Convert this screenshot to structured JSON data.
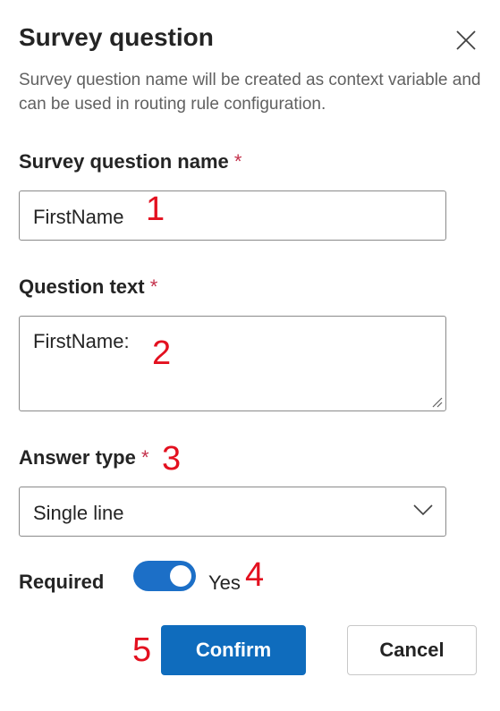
{
  "dialog": {
    "title": "Survey question",
    "description": "Survey question name will be created as context variable and can be used in routing rule configuration."
  },
  "fields": {
    "name": {
      "label": "Survey question name",
      "required_mark": "*",
      "value": "FirstName"
    },
    "question_text": {
      "label": "Question text",
      "required_mark": "*",
      "value": "FirstName:"
    },
    "answer_type": {
      "label": "Answer type",
      "required_mark": "*",
      "selected": "Single line"
    },
    "required": {
      "label": "Required",
      "state_text": "Yes",
      "on": true
    }
  },
  "buttons": {
    "confirm": "Confirm",
    "cancel": "Cancel"
  },
  "markers": [
    "1",
    "2",
    "3",
    "4",
    "5"
  ],
  "colors": {
    "accent": "#0f6cbd",
    "required_star": "#c4314b",
    "annotation": "#e3101f"
  }
}
